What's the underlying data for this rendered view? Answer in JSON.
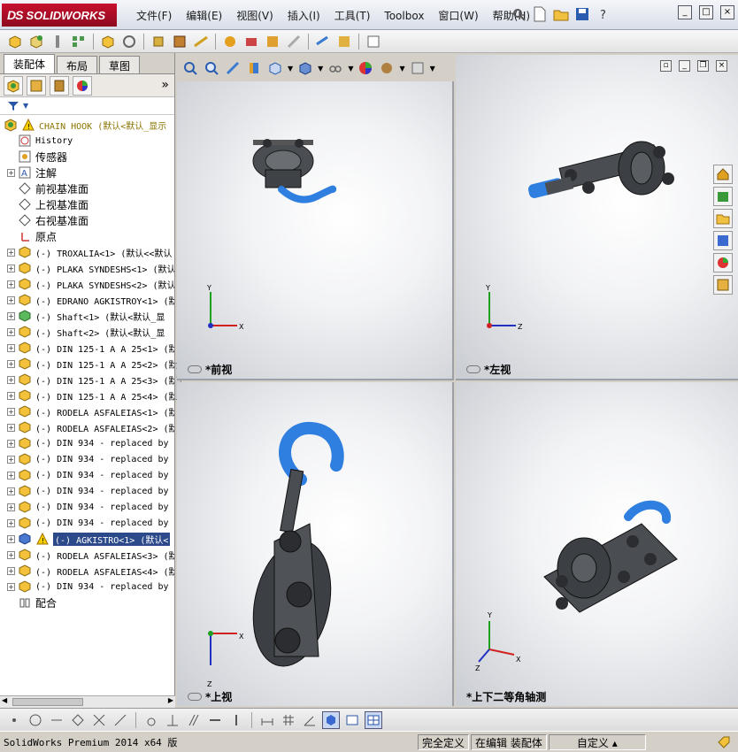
{
  "app": {
    "logo_text": "SOLIDWORKS",
    "logo_prefix": "DS",
    "menu": [
      "文件(F)",
      "编辑(E)",
      "视图(V)",
      "插入(I)",
      "工具(T)",
      "Toolbox",
      "窗口(W)",
      "帮助(H)"
    ]
  },
  "left_panel": {
    "tabs": [
      "装配体",
      "布局",
      "草图"
    ],
    "tree": {
      "root": "CHAIN HOOK  (默认<默认_显示",
      "items": [
        {
          "label": "History",
          "expandable": false,
          "icon": "history-icon",
          "cjk": false
        },
        {
          "label": "传感器",
          "expandable": false,
          "icon": "sensor-icon",
          "cjk": true
        },
        {
          "label": "注解",
          "expandable": true,
          "icon": "annotation-icon",
          "cjk": true
        },
        {
          "label": "前视基准面",
          "expandable": false,
          "icon": "plane-icon",
          "cjk": true
        },
        {
          "label": "上视基准面",
          "expandable": false,
          "icon": "plane-icon",
          "cjk": true
        },
        {
          "label": "右视基准面",
          "expandable": false,
          "icon": "plane-icon",
          "cjk": true
        },
        {
          "label": "原点",
          "expandable": false,
          "icon": "origin-icon",
          "cjk": true
        },
        {
          "label": "(-) TROXALIA<1> (默认<<默认",
          "expandable": true,
          "icon": "part-icon",
          "cjk": false
        },
        {
          "label": "(-) PLAKA SYNDESHS<1> (默认",
          "expandable": true,
          "icon": "part-icon",
          "cjk": false
        },
        {
          "label": "(-) PLAKA SYNDESHS<2> (默认",
          "expandable": true,
          "icon": "part-icon",
          "cjk": false
        },
        {
          "label": "(-) EDRANO AGKISTROY<1> (默",
          "expandable": true,
          "icon": "part-icon",
          "cjk": false
        },
        {
          "label": "(-) Shaft<1> (默认<默认_显",
          "expandable": true,
          "icon": "part-icon-green",
          "cjk": false
        },
        {
          "label": "(-) Shaft<2> (默认<默认_显",
          "expandable": true,
          "icon": "part-icon",
          "cjk": false
        },
        {
          "label": "(-) DIN 125-1 A A 25<1> (默",
          "expandable": true,
          "icon": "part-icon",
          "cjk": false
        },
        {
          "label": "(-) DIN 125-1 A A 25<2> (默",
          "expandable": true,
          "icon": "part-icon",
          "cjk": false
        },
        {
          "label": "(-) DIN 125-1 A A 25<3> (默",
          "expandable": true,
          "icon": "part-icon",
          "cjk": false
        },
        {
          "label": "(-) DIN 125-1 A A 25<4> (默",
          "expandable": true,
          "icon": "part-icon",
          "cjk": false
        },
        {
          "label": "(-) RODELA ASFALEIAS<1> (默",
          "expandable": true,
          "icon": "part-icon",
          "cjk": false
        },
        {
          "label": "(-) RODELA ASFALEIAS<2> (默",
          "expandable": true,
          "icon": "part-icon",
          "cjk": false
        },
        {
          "label": "(-) DIN 934 - replaced by",
          "expandable": true,
          "icon": "part-icon",
          "cjk": false
        },
        {
          "label": "(-) DIN 934 - replaced by",
          "expandable": true,
          "icon": "part-icon",
          "cjk": false
        },
        {
          "label": "(-) DIN 934 - replaced by",
          "expandable": true,
          "icon": "part-icon",
          "cjk": false
        },
        {
          "label": "(-) DIN 934 - replaced by",
          "expandable": true,
          "icon": "part-icon",
          "cjk": false
        },
        {
          "label": "(-) DIN 934 - replaced by",
          "expandable": true,
          "icon": "part-icon",
          "cjk": false
        },
        {
          "label": "(-) DIN 934 - replaced by",
          "expandable": true,
          "icon": "part-icon",
          "cjk": false
        },
        {
          "label": "(-) AGKISTRO<1> (默认<",
          "expandable": true,
          "icon": "part-icon-blue",
          "cjk": false,
          "selected": true,
          "warning": true
        },
        {
          "label": "(-) RODELA ASFALEIAS<3> (默",
          "expandable": true,
          "icon": "part-icon",
          "cjk": false
        },
        {
          "label": "(-) RODELA ASFALEIAS<4> (默",
          "expandable": true,
          "icon": "part-icon",
          "cjk": false
        },
        {
          "label": "(-) DIN 934 - replaced by",
          "expandable": true,
          "icon": "part-icon",
          "cjk": false
        },
        {
          "label": "配合",
          "expandable": false,
          "icon": "mate-icon",
          "cjk": true
        }
      ]
    }
  },
  "viewports": {
    "front": {
      "label": "*前视",
      "axes": [
        "Y",
        "X"
      ]
    },
    "left": {
      "label": "*左视",
      "axes": [
        "Y",
        "Z"
      ]
    },
    "top": {
      "label": "*上视",
      "axes": [
        "X",
        "Z"
      ]
    },
    "iso": {
      "label": "*上下二等角轴测",
      "axes": [
        "Y",
        "X",
        "Z"
      ]
    }
  },
  "status": {
    "app_version": "SolidWorks Premium 2014 x64 版",
    "state": "完全定义",
    "mode": "在编辑 装配体",
    "custom": "自定义"
  },
  "colors": {
    "accent_blue": "#2f7fe0",
    "part_gray": "#4a4d52",
    "axis_red": "#d02020",
    "axis_green": "#20a020",
    "axis_blue": "#2030c0"
  }
}
